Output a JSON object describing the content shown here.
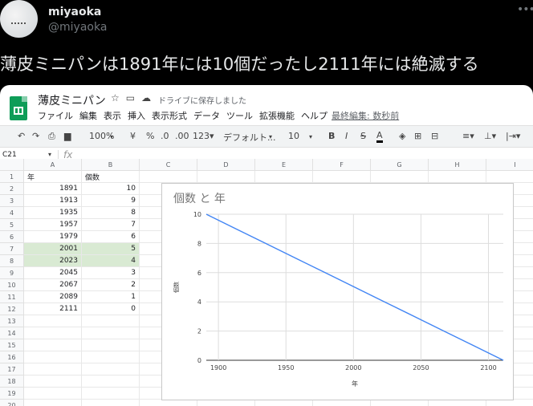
{
  "tweet": {
    "user_name": "miyaoka",
    "handle": "@miyaoka",
    "more_icon": "more-horizontal-icon",
    "text": "薄皮ミニパンは1891年には10個だったし2111年には絶滅する"
  },
  "sheets": {
    "doc_title": "薄皮ミニパン",
    "save_status": "ドライブに保存しました",
    "menu": [
      "ファイル",
      "編集",
      "表示",
      "挿入",
      "表示形式",
      "データ",
      "ツール",
      "拡張機能",
      "ヘルプ"
    ],
    "last_edit": "最終編集: 数秒前",
    "toolbar": {
      "zoom": "100%",
      "currency": "¥",
      "percent": "%",
      "decrease_decimal": ".0",
      "increase_decimal": ".00",
      "number_format": "123▾",
      "font": "デフォルト...",
      "font_size": "10"
    },
    "name_box": "C21",
    "fx_label": "fx",
    "columns": [
      "A",
      "B",
      "C",
      "D",
      "E",
      "F",
      "G",
      "H",
      "I"
    ],
    "rows": [
      {
        "n": "1",
        "a": "年",
        "b": "個数"
      },
      {
        "n": "2",
        "a": "1891",
        "b": "10"
      },
      {
        "n": "3",
        "a": "1913",
        "b": "9"
      },
      {
        "n": "4",
        "a": "1935",
        "b": "8"
      },
      {
        "n": "5",
        "a": "1957",
        "b": "7"
      },
      {
        "n": "6",
        "a": "1979",
        "b": "6"
      },
      {
        "n": "7",
        "a": "2001",
        "b": "5"
      },
      {
        "n": "8",
        "a": "2023",
        "b": "4"
      },
      {
        "n": "9",
        "a": "2045",
        "b": "3"
      },
      {
        "n": "10",
        "a": "2067",
        "b": "2"
      },
      {
        "n": "11",
        "a": "2089",
        "b": "1"
      },
      {
        "n": "12",
        "a": "2111",
        "b": "0"
      },
      {
        "n": "13",
        "a": "",
        "b": ""
      },
      {
        "n": "14",
        "a": "",
        "b": ""
      },
      {
        "n": "15",
        "a": "",
        "b": ""
      },
      {
        "n": "16",
        "a": "",
        "b": ""
      },
      {
        "n": "17",
        "a": "",
        "b": ""
      },
      {
        "n": "18",
        "a": "",
        "b": ""
      },
      {
        "n": "19",
        "a": "",
        "b": ""
      },
      {
        "n": "20",
        "a": "",
        "b": ""
      }
    ],
    "highlight_rows": [
      "7",
      "8"
    ],
    "colors": {
      "line": "#4285f4",
      "highlight": "#d9ead3",
      "logo": "#0f9d58"
    }
  },
  "chart_data": {
    "type": "line",
    "title": "個数 と 年",
    "xlabel": "年",
    "ylabel": "個数",
    "x": [
      1891,
      1913,
      1935,
      1957,
      1979,
      2001,
      2023,
      2045,
      2067,
      2089,
      2111
    ],
    "series": [
      {
        "values": [
          10,
          9,
          8,
          7,
          6,
          5,
          4,
          3,
          2,
          1,
          0
        ]
      }
    ],
    "xticks": [
      1900,
      1950,
      2000,
      2050,
      2100
    ],
    "yticks": [
      0,
      2,
      4,
      6,
      8,
      10
    ],
    "xlim": [
      1891,
      2111
    ],
    "ylim": [
      0,
      10
    ],
    "grid": true,
    "legend": "none"
  }
}
